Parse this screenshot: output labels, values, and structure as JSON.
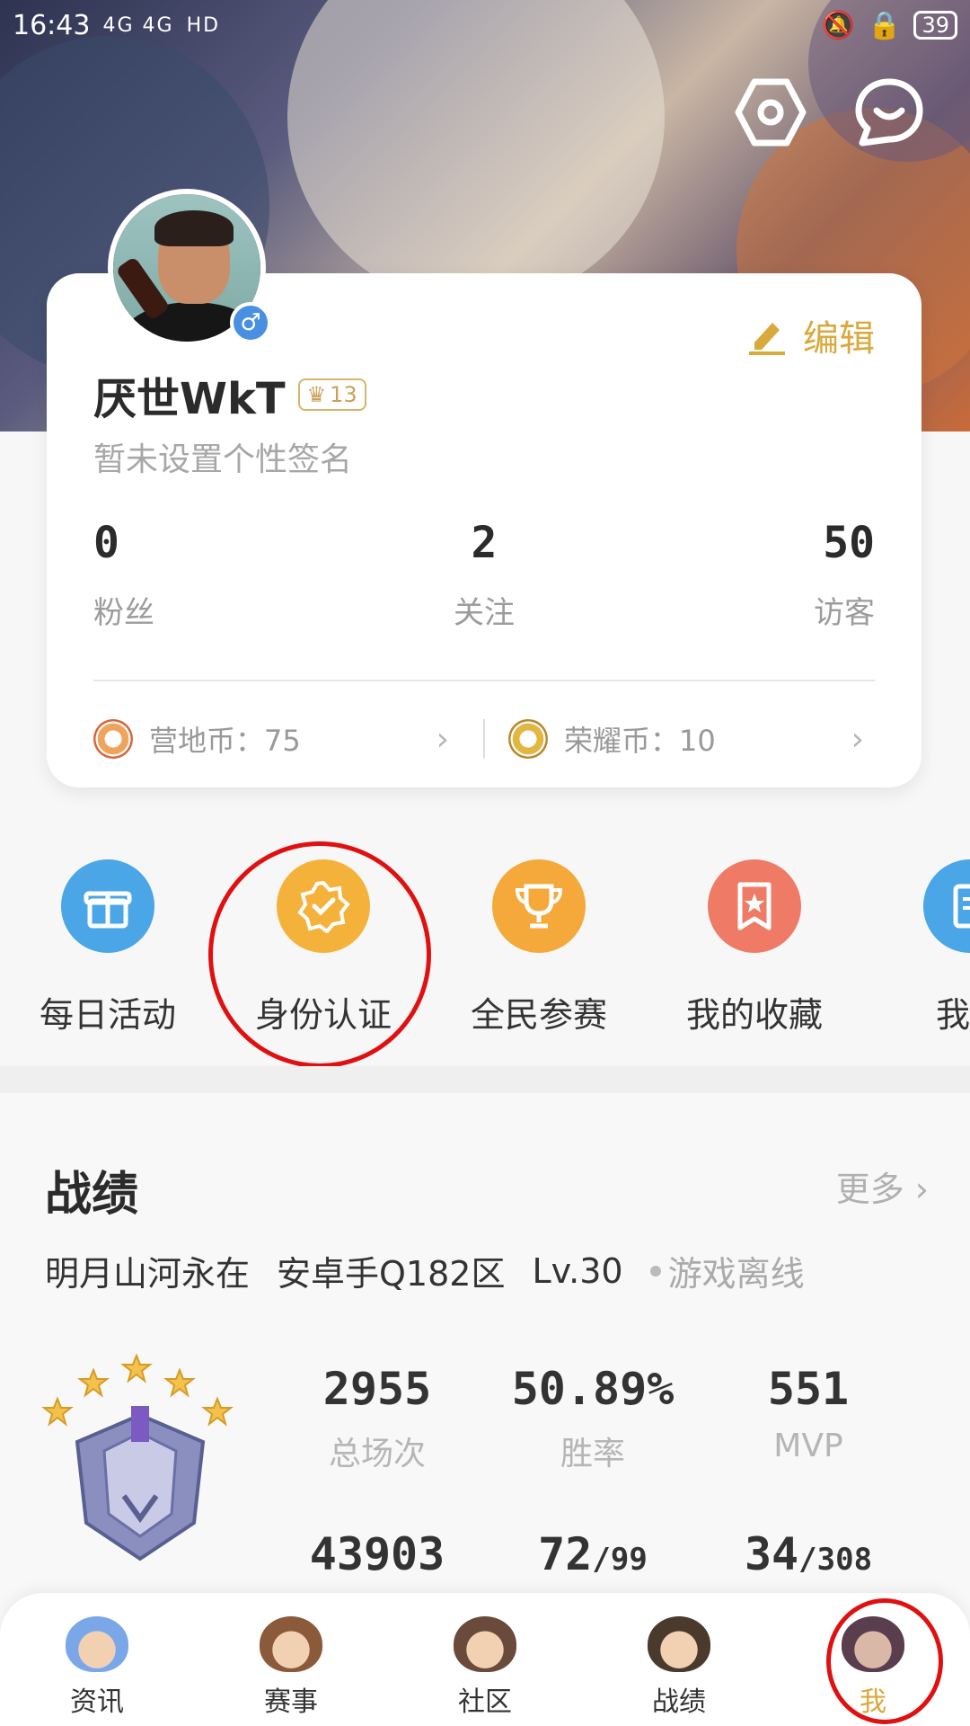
{
  "status_bar": {
    "time": "16:43",
    "signal": "4G 4G",
    "hd": "HD",
    "battery": "39"
  },
  "profile": {
    "edit_label": "编辑",
    "name": "厌世WkT",
    "level": "13",
    "signature": "暂未设置个性签名",
    "gender_symbol": "♂",
    "stats": [
      {
        "value": "0",
        "label": "粉丝"
      },
      {
        "value": "2",
        "label": "关注"
      },
      {
        "value": "50",
        "label": "访客"
      }
    ],
    "coins": [
      {
        "label": "营地币：75"
      },
      {
        "label": "荣耀币：10"
      }
    ]
  },
  "actions": [
    {
      "label": "每日活动",
      "color": "#4aa6e6",
      "icon": "gift-icon"
    },
    {
      "label": "身份认证",
      "color": "#f5b23b",
      "icon": "verified-badge-icon"
    },
    {
      "label": "全民参赛",
      "color": "#f5a93a",
      "icon": "trophy-icon"
    },
    {
      "label": "我的收藏",
      "color": "#ef7b66",
      "icon": "bookmark-star-icon"
    },
    {
      "label": "我的",
      "color": "#4aa6e6",
      "icon": "document-icon"
    }
  ],
  "record": {
    "title": "战绩",
    "more": "更多",
    "role_name": "明月山河永在",
    "server": "安卓手Q182区",
    "level": "Lv.30",
    "status": "游戏离线",
    "row1": [
      {
        "value": "2955",
        "label": "总场次"
      },
      {
        "value": "50.89%",
        "label": "胜率"
      },
      {
        "value": "551",
        "label": "MVP"
      }
    ],
    "row2": [
      {
        "value": "43903",
        "small": ""
      },
      {
        "value": "72",
        "small": "/99"
      },
      {
        "value": "34",
        "small": "/308"
      }
    ]
  },
  "bottom_nav": [
    {
      "label": "资讯",
      "active": false
    },
    {
      "label": "赛事",
      "active": false
    },
    {
      "label": "社区",
      "active": false
    },
    {
      "label": "战绩",
      "active": false
    },
    {
      "label": "我",
      "active": true
    }
  ],
  "colors": {
    "accent": "#d9a93c",
    "highlight_ring": "#e01010"
  }
}
